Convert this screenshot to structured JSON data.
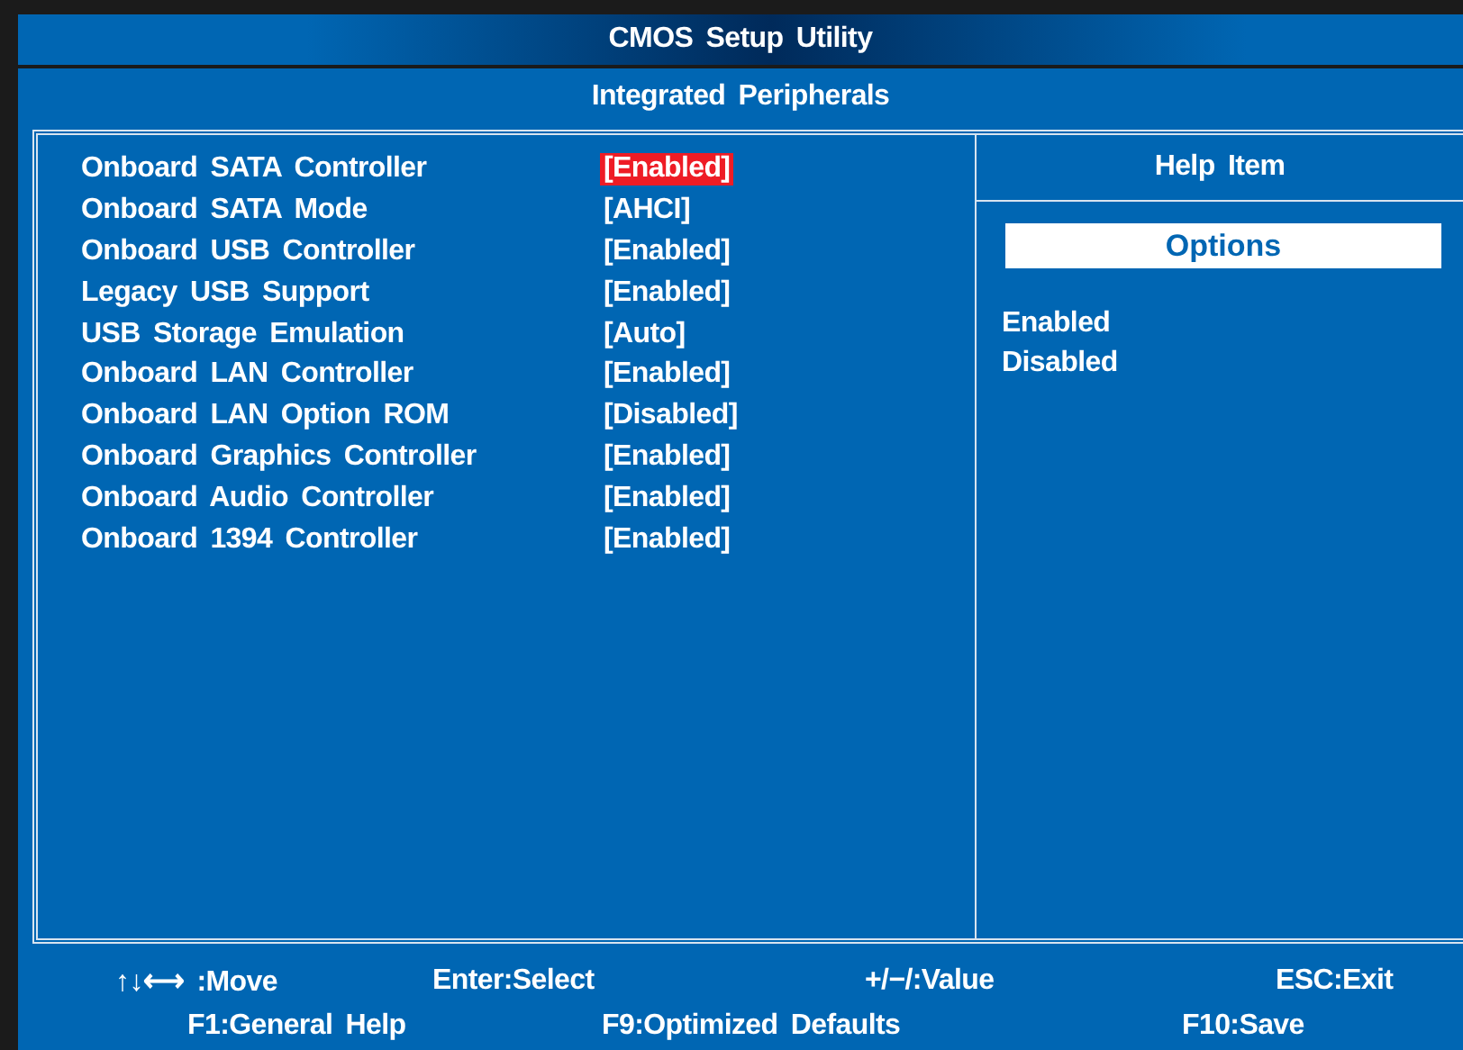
{
  "window": {
    "title": "CMOS Setup Utility"
  },
  "page": {
    "title": "Integrated Peripherals"
  },
  "settings": [
    {
      "label": "Onboard SATA Controller",
      "value": "[Enabled]",
      "selected": true
    },
    {
      "label": "Onboard SATA Mode",
      "value": "[AHCI]",
      "selected": false
    },
    {
      "label": "Onboard USB Controller",
      "value": "[Enabled]",
      "selected": false
    },
    {
      "label": "Legacy USB Support",
      "value": "[Enabled]",
      "selected": false
    },
    {
      "label": "USB Storage Emulation",
      "value": "[Auto]",
      "selected": false
    },
    {
      "label": "Onboard LAN Controller",
      "value": "[Enabled]",
      "selected": false
    },
    {
      "label": "Onboard LAN Option ROM",
      "value": "[Disabled]",
      "selected": false
    },
    {
      "label": "Onboard Graphics Controller",
      "value": "[Enabled]",
      "selected": false
    },
    {
      "label": "Onboard Audio Controller",
      "value": "[Enabled]",
      "selected": false
    },
    {
      "label": "Onboard 1394 Controller",
      "value": "[Enabled]",
      "selected": false
    }
  ],
  "help": {
    "title": "Help Item",
    "options_heading": "Options",
    "options": [
      "Enabled",
      "Disabled"
    ]
  },
  "footer": {
    "rows": [
      [
        "↑↓⟷ :Move",
        "Enter:Select",
        "+/−/:Value",
        "ESC:Exit"
      ],
      [
        "F1:General Help",
        "F9:Optimized Defaults",
        "F10:Save"
      ]
    ]
  }
}
